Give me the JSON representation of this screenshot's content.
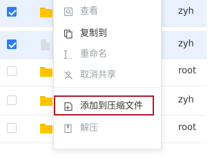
{
  "rows": [
    {
      "selected": true,
      "checked": true,
      "type": "folder",
      "owner": "zyh"
    },
    {
      "selected": true,
      "checked": true,
      "type": "file",
      "owner": "zyh"
    },
    {
      "selected": false,
      "checked": false,
      "type": "folder",
      "owner": "root"
    },
    {
      "selected": false,
      "checked": false,
      "type": "folder",
      "owner": "zyh"
    },
    {
      "selected": false,
      "checked": false,
      "type": "folder",
      "owner": "root"
    }
  ],
  "context_menu": {
    "items": [
      {
        "label": "查看",
        "icon": "search-icon",
        "enabled": false
      },
      {
        "label": "复制到",
        "icon": "copy-icon",
        "enabled": true
      },
      {
        "label": "重命名",
        "icon": "rename-icon",
        "enabled": false
      },
      {
        "label": "取消共享",
        "icon": "unshare-icon",
        "enabled": false
      },
      {
        "label": "添加到压缩文件",
        "icon": "add-to-archive-icon",
        "enabled": true,
        "highlighted": true
      },
      {
        "label": "解压",
        "icon": "extract-icon",
        "enabled": false
      }
    ]
  },
  "colors": {
    "accent": "#2d7cf6",
    "selected_row": "#e8f1fd",
    "highlight_border": "#b0172b",
    "folder": "#ffc400"
  }
}
